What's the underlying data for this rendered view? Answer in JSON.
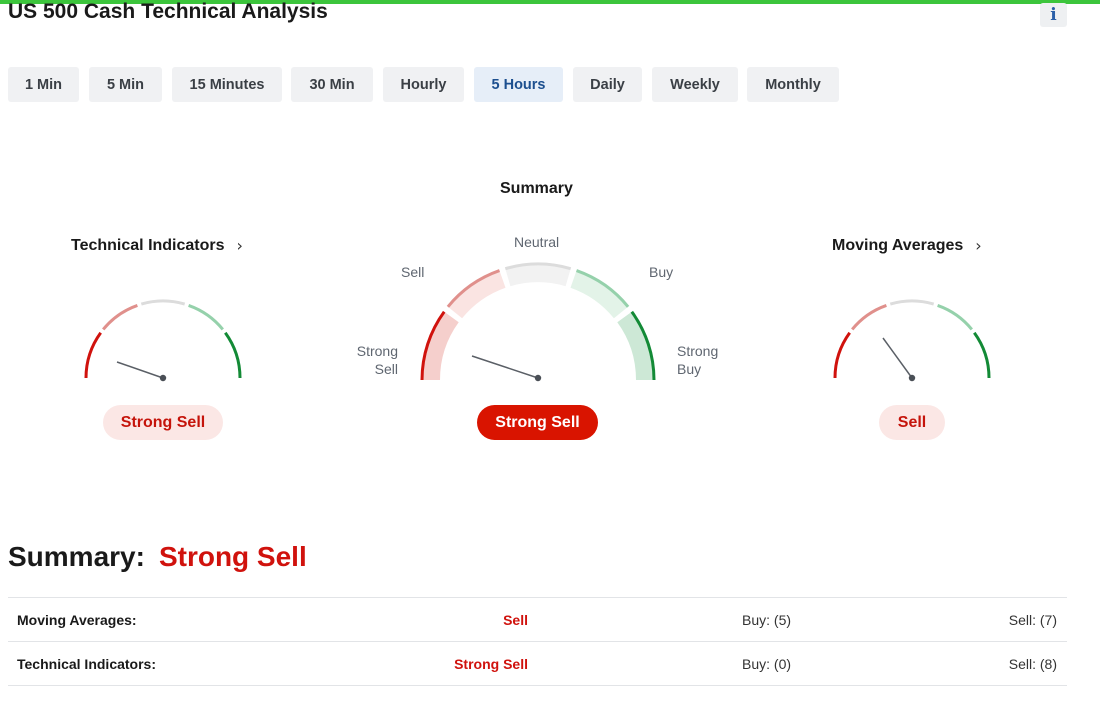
{
  "page": {
    "title": "US 500 Cash Technical Analysis",
    "info_icon": "i"
  },
  "timeframes": [
    {
      "label": "1 Min",
      "active": false
    },
    {
      "label": "5 Min",
      "active": false
    },
    {
      "label": "15 Minutes",
      "active": false
    },
    {
      "label": "30 Min",
      "active": false
    },
    {
      "label": "Hourly",
      "active": false
    },
    {
      "label": "5 Hours",
      "active": true
    },
    {
      "label": "Daily",
      "active": false
    },
    {
      "label": "Weekly",
      "active": false
    },
    {
      "label": "Monthly",
      "active": false
    }
  ],
  "gauges": {
    "summary_heading": "Summary",
    "technical_indicators": {
      "title": "Technical Indicators",
      "chevron_icon": "chevron-right-icon",
      "verdict": "Strong Sell"
    },
    "summary": {
      "verdict": "Strong Sell",
      "labels": {
        "strong_sell_1": "Strong",
        "strong_sell_2": "Sell",
        "sell": "Sell",
        "neutral": "Neutral",
        "buy": "Buy",
        "strong_buy_1": "Strong",
        "strong_buy_2": "Buy"
      }
    },
    "moving_averages": {
      "title": "Moving Averages",
      "chevron_icon": "chevron-right-icon",
      "verdict": "Sell"
    }
  },
  "colors": {
    "strong_sell": "#d0120d",
    "sell": "#e0908c",
    "neutral": "#dcdcdc",
    "buy": "#95d1ab",
    "strong_buy": "#138a36",
    "accent_bar": "#3cc53c"
  },
  "summary": {
    "label": "Summary:",
    "value": "Strong Sell",
    "rows": [
      {
        "name": "Moving Averages:",
        "verdict": "Sell",
        "buy": "Buy: (5)",
        "sell": "Sell: (7)"
      },
      {
        "name": "Technical Indicators:",
        "verdict": "Strong Sell",
        "buy": "Buy: (0)",
        "sell": "Sell: (8)"
      }
    ]
  }
}
